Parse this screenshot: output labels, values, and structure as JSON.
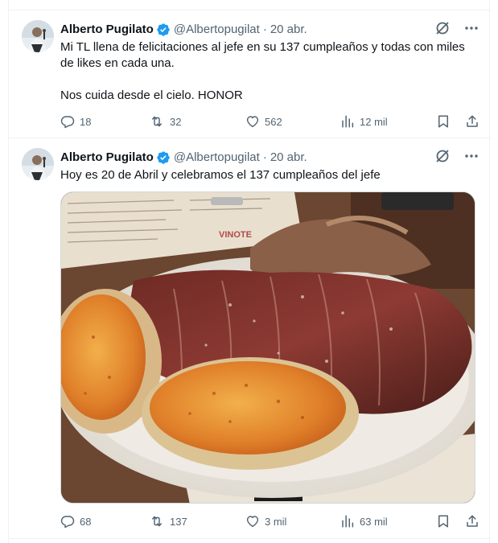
{
  "colors": {
    "text": "#0f1419",
    "secondary": "#536471",
    "verified": "#1d9bf0",
    "border": "#eff3f4"
  },
  "tweets": [
    {
      "name": "Alberto Pugilato",
      "handle": "@Albertopugilat",
      "separator": "·",
      "date": "20 abr.",
      "text_lines": [
        "Mi TL llena de felicitaciones al jefe en su 137 cumpleaños y todas con miles de likes en cada una.",
        "Nos cuida desde el cielo. HONOR"
      ],
      "replies": "18",
      "retweets": "32",
      "likes": "562",
      "views": "12 mil"
    },
    {
      "name": "Alberto Pugilato",
      "handle": "@Albertopugilat",
      "separator": "·",
      "date": "20 abr.",
      "text_lines": [
        "Hoy es 20 de Abril y celebramos el 137 cumpleaños del jefe"
      ],
      "media_text": "VINOTE",
      "replies": "68",
      "retweets": "137",
      "likes": "3 mil",
      "views": "63 mil"
    }
  ],
  "icons": {
    "avatar": "avatar-icon",
    "verified": "verified-badge-icon",
    "grok": "grok-icon",
    "more": "more-icon",
    "reply": "reply-icon",
    "retweet": "retweet-icon",
    "like": "heart-icon",
    "views": "views-icon",
    "bookmark": "bookmark-icon",
    "share": "share-icon"
  }
}
